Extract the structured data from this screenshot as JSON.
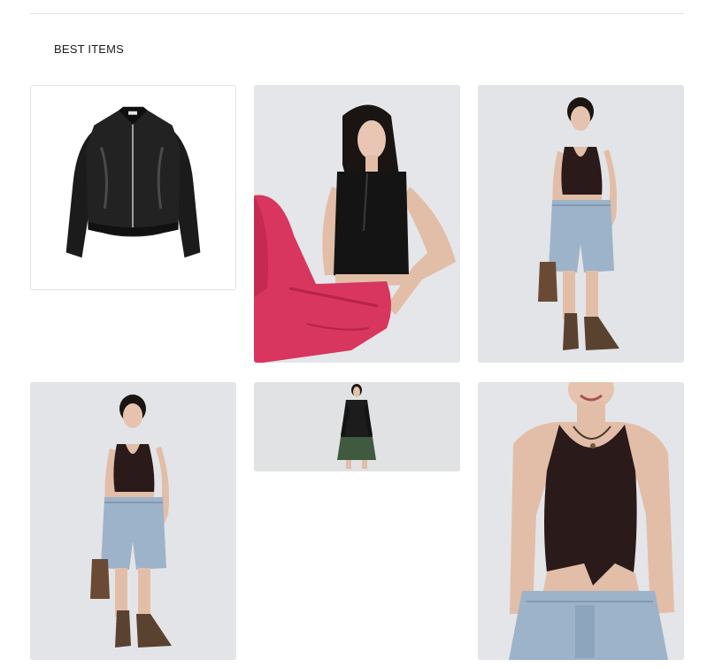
{
  "section": {
    "title": "BEST ITEMS"
  },
  "products": [
    {
      "image": "black-leather-zip-jacket"
    },
    {
      "image": "model-black-zip-knit-pink-pants"
    },
    {
      "image": "model-halter-top-denim-shorts"
    },
    {
      "image": "model-halter-top-denim-shorts-alt"
    },
    {
      "image": "model-black-knit-green-skirt"
    },
    {
      "image": "model-halter-top-closeup"
    }
  ],
  "colors": {
    "photo_background": "#e4e5e7",
    "jacket": "#1b1b1b",
    "pants_pink": "#d8355f",
    "denim": "#9db3c9",
    "halter_brown": "#2b1a1a",
    "boots": "#5a4230"
  }
}
